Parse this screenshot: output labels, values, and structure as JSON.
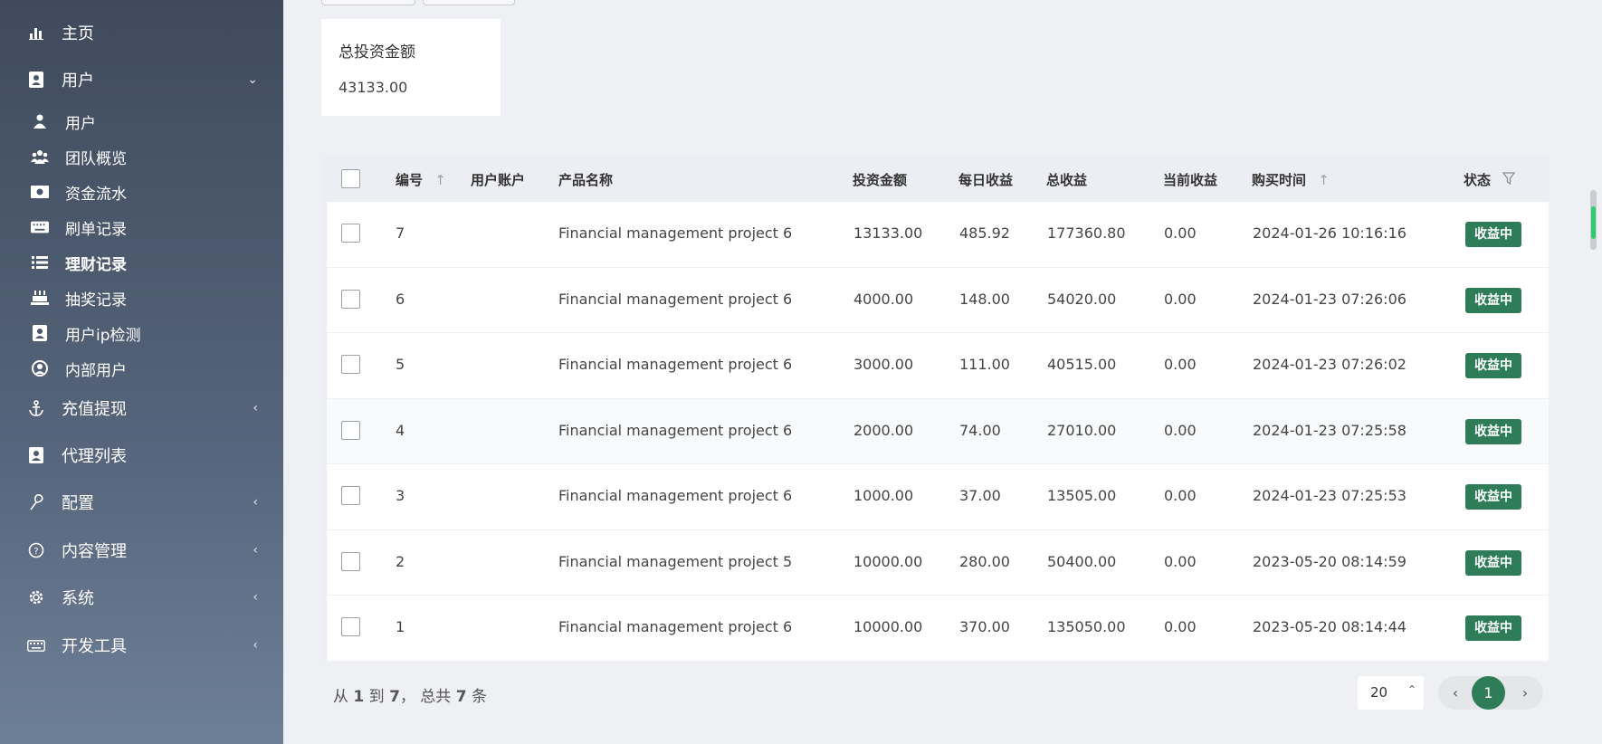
{
  "sidebar": {
    "items": [
      {
        "label": "主页",
        "icon": "bar-chart-icon"
      },
      {
        "label": "用户",
        "icon": "user-card-icon",
        "chevron": "⌄"
      },
      {
        "label": "用户",
        "icon": "person-icon"
      },
      {
        "label": "团队概览",
        "icon": "team-icon"
      },
      {
        "label": "资金流水",
        "icon": "money-icon"
      },
      {
        "label": "刷单记录",
        "icon": "keyboard-icon"
      },
      {
        "label": "理财记录",
        "icon": "list-icon"
      },
      {
        "label": "抽奖记录",
        "icon": "cake-icon"
      },
      {
        "label": "用户ip检测",
        "icon": "user-card-icon"
      },
      {
        "label": "内部用户",
        "icon": "user-circle-icon"
      },
      {
        "label": "充值提现",
        "icon": "anchor-icon",
        "chevron": "‹"
      },
      {
        "label": "代理列表",
        "icon": "user-card-icon"
      },
      {
        "label": "配置",
        "icon": "config-icon",
        "chevron": "‹"
      },
      {
        "label": "内容管理",
        "icon": "help-circle-icon",
        "chevron": "‹"
      },
      {
        "label": "系统",
        "icon": "gear-icon",
        "chevron": "‹"
      },
      {
        "label": "开发工具",
        "icon": "keyboard-icon",
        "chevron": "‹"
      }
    ]
  },
  "stat": {
    "title": "总投资金额",
    "value": "43133.00"
  },
  "table": {
    "headers": {
      "id": "编号",
      "account": "用户账户",
      "product": "产品名称",
      "amount": "投资金额",
      "daily": "每日收益",
      "total": "总收益",
      "current": "当前收益",
      "time": "购买时间",
      "status": "状态"
    },
    "rows": [
      {
        "id": "7",
        "account": "",
        "product": "Financial management project 6",
        "amount": "13133.00",
        "daily": "485.92",
        "total": "177360.80",
        "current": "0.00",
        "time": "2024-01-26 10:16:16",
        "status": "收益中"
      },
      {
        "id": "6",
        "account": "",
        "product": "Financial management project 6",
        "amount": "4000.00",
        "daily": "148.00",
        "total": "54020.00",
        "current": "0.00",
        "time": "2024-01-23 07:26:06",
        "status": "收益中"
      },
      {
        "id": "5",
        "account": "",
        "product": "Financial management project 6",
        "amount": "3000.00",
        "daily": "111.00",
        "total": "40515.00",
        "current": "0.00",
        "time": "2024-01-23 07:26:02",
        "status": "收益中"
      },
      {
        "id": "4",
        "account": "",
        "product": "Financial management project 6",
        "amount": "2000.00",
        "daily": "74.00",
        "total": "27010.00",
        "current": "0.00",
        "time": "2024-01-23 07:25:58",
        "status": "收益中"
      },
      {
        "id": "3",
        "account": "",
        "product": "Financial management project 6",
        "amount": "1000.00",
        "daily": "37.00",
        "total": "13505.00",
        "current": "0.00",
        "time": "2024-01-23 07:25:53",
        "status": "收益中"
      },
      {
        "id": "2",
        "account": "",
        "product": "Financial management project 5",
        "amount": "10000.00",
        "daily": "280.00",
        "total": "50400.00",
        "current": "0.00",
        "time": "2023-05-20 08:14:59",
        "status": "收益中"
      },
      {
        "id": "1",
        "account": "",
        "product": "Financial management project 6",
        "amount": "10000.00",
        "daily": "370.00",
        "total": "135050.00",
        "current": "0.00",
        "time": "2023-05-20 08:14:44",
        "status": "收益中"
      }
    ]
  },
  "footer": {
    "from_label": "从",
    "from": "1",
    "to_label": "到",
    "to": "7",
    "total_label": "，  总共",
    "total": "7",
    "unit": "条",
    "page_size": "20",
    "current_page": "1"
  },
  "colors": {
    "accent": "#2f7d58",
    "sidebar": "#4b576b"
  }
}
